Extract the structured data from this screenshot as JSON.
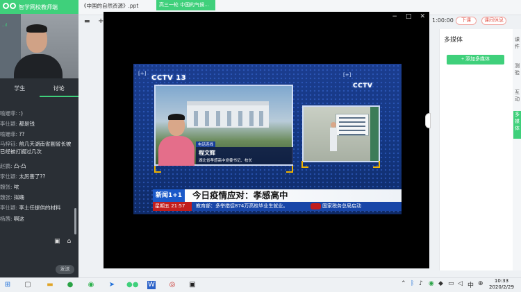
{
  "app": {
    "name": "智学网校教师端"
  },
  "left_panel": {
    "signal": "..ıl",
    "tabs": [
      {
        "label": "学生"
      },
      {
        "label": "讨论"
      }
    ],
    "chat": [
      {
        "name": "喻姗菲:",
        "text": ":)"
      },
      {
        "name": "李仕颖:",
        "text": "都是钱"
      },
      {
        "name": "喻姗菲:",
        "text": "??"
      },
      {
        "name": "马梓钰:",
        "text": "前几天湖南省副省长被已经被打掘过几次"
      },
      {
        "name": "赵鹏:",
        "text": "凸-凸"
      },
      {
        "name": "李仕颖:",
        "text": "太厉害了??"
      },
      {
        "name": "魏张:",
        "text": "哝"
      },
      {
        "name": "魏张:",
        "text": "拟确"
      },
      {
        "name": "李仕颖:",
        "text": "李土任提供的材料"
      },
      {
        "name": "杨茜:",
        "text": "啊这"
      }
    ],
    "send_label": "发送"
  },
  "topbar": {
    "file_tab": "《中国的自然资源》.ppt",
    "active_tab": "高三一轮 中国的气候...",
    "timer": "1:00:00",
    "next_button": "下课",
    "break_button": "课间休息"
  },
  "stage": {
    "controls": {
      "minimize": "−",
      "maximize": "□",
      "close": "✕"
    }
  },
  "video": {
    "channel_logo": "CCTV 13",
    "channel_sub": "新闻",
    "plus_tag": "[+]",
    "logo_right": "CCTV",
    "call_badge": "电话连线",
    "person_name": "程文辉",
    "person_title": "湖北省孝感高中党委书记、校长",
    "tag": "新闻1+1",
    "headline": "今日疫情应对：孝感高中",
    "day": "星期五  21:57",
    "ticker": "教育部：多举措促874万高校毕业生就业。",
    "ticker2": "国家税务总局启动"
  },
  "right_panel": {
    "title": "多媒体",
    "add_button": "+ 添加多媒体",
    "nav": [
      {
        "label": "课件"
      },
      {
        "label": "测验"
      },
      {
        "label": "互动"
      },
      {
        "label": "多媒体"
      }
    ]
  },
  "taskbar": {
    "time": "10:33",
    "date": "2020/2/29",
    "ime": "中"
  }
}
